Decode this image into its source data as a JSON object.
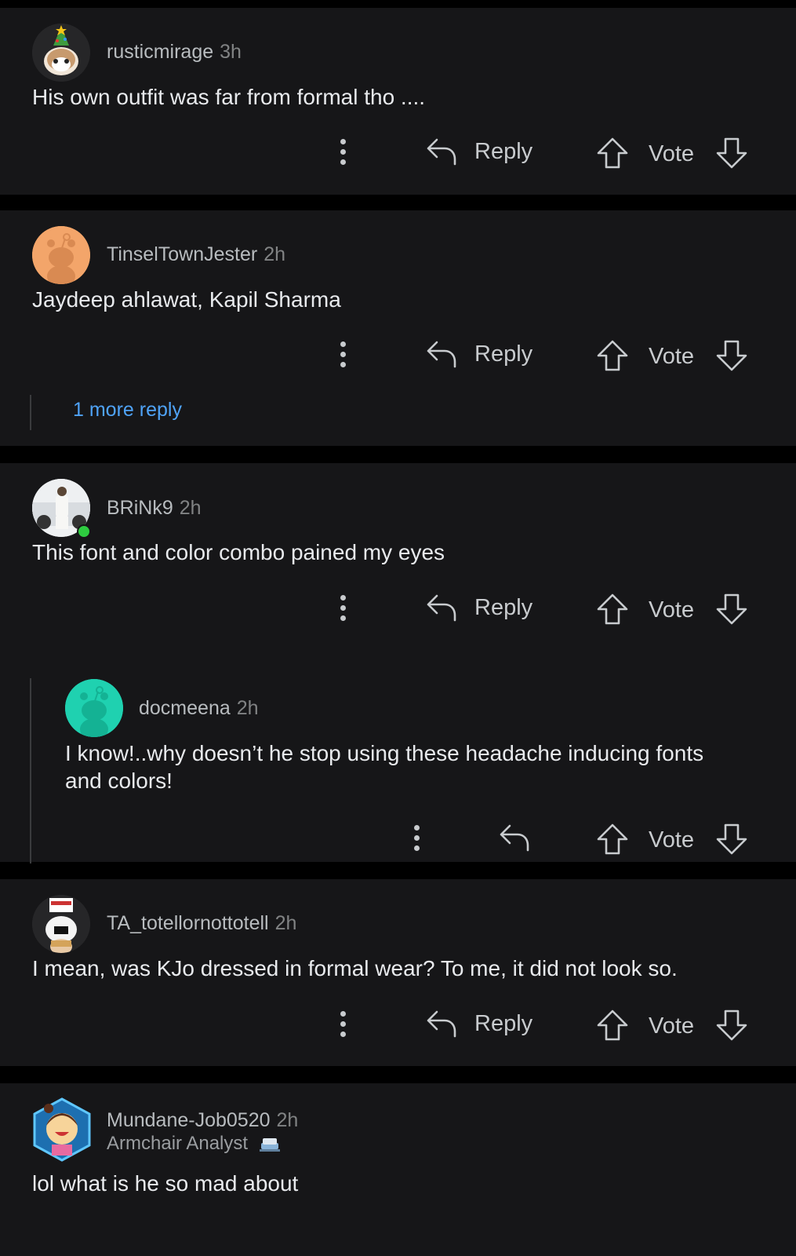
{
  "comments": [
    {
      "username": "rusticmirage",
      "age": "3h",
      "text": "His own outfit was far from formal tho ....",
      "reply_label": "Reply",
      "vote_label": "Vote"
    },
    {
      "username": "TinselTownJester",
      "age": "2h",
      "text": "Jaydeep ahlawat, Kapil Sharma",
      "reply_label": "Reply",
      "vote_label": "Vote",
      "more_replies": "1 more reply"
    },
    {
      "username": "BRiNk9",
      "age": "2h",
      "text": "This font and color combo pained my eyes",
      "reply_label": "Reply",
      "vote_label": "Vote",
      "reply": {
        "username": "docmeena",
        "age": "2h",
        "text_line1": "I know!..why doesn’t he stop using these headache inducing fonts",
        "text_line2": "and colors!",
        "vote_label": "Vote"
      }
    },
    {
      "username": "TA_totellornottotell",
      "age": "2h",
      "text": "I mean, was KJo dressed in formal wear? To me, it did not look so.",
      "reply_label": "Reply",
      "vote_label": "Vote"
    },
    {
      "username": "Mundane-Job0520",
      "age": "2h",
      "flair": "Armchair Analyst",
      "text": "lol what is he so mad about"
    }
  ],
  "icons": {
    "more": "vertical-dots-icon",
    "reply": "reply-arrow-icon",
    "upvote": "upvote-arrow-icon",
    "downvote": "downvote-arrow-icon"
  },
  "colors": {
    "background": "#000000",
    "card": "#161618",
    "link": "#4fa3f7",
    "online": "#2ecc40"
  }
}
